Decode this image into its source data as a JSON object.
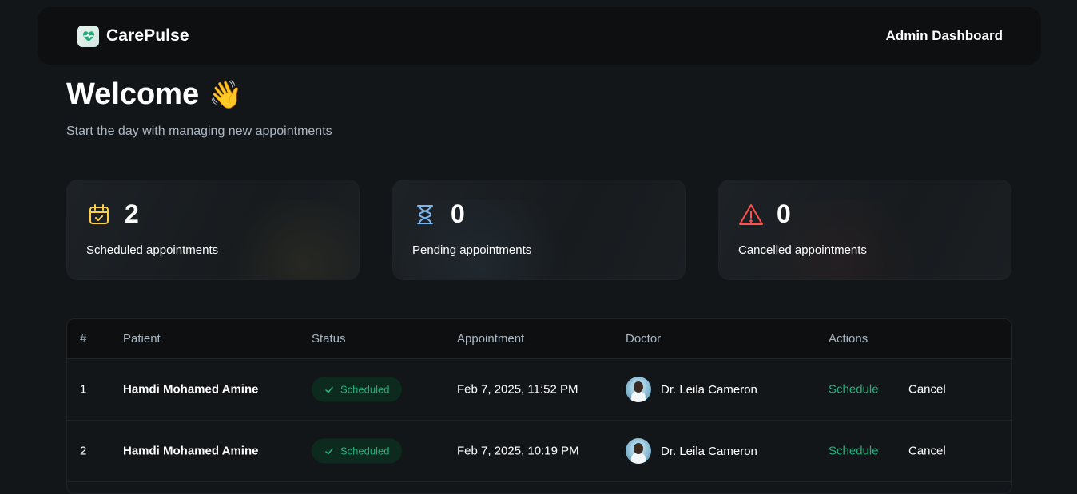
{
  "header": {
    "logo_text": "CarePulse",
    "admin_title": "Admin Dashboard"
  },
  "welcome": {
    "title": "Welcome",
    "emoji": "👋",
    "subtitle": "Start the day with managing new appointments"
  },
  "stats": {
    "scheduled": {
      "count": "2",
      "label": "Scheduled appointments",
      "icon": "calendar-check-icon",
      "color": "#ffd147"
    },
    "pending": {
      "count": "0",
      "label": "Pending appointments",
      "icon": "hourglass-icon",
      "color": "#79b5ec"
    },
    "cancelled": {
      "count": "0",
      "label": "Cancelled appointments",
      "icon": "warning-icon",
      "color": "#ff4f4e"
    }
  },
  "table": {
    "headers": [
      "#",
      "Patient",
      "Status",
      "Appointment",
      "Doctor",
      "Actions"
    ],
    "rows": [
      {
        "num": "1",
        "patient": "Hamdi Mohamed Amine",
        "status": "Scheduled",
        "appointment": "Feb 7, 2025, 11:52 PM",
        "doctor": "Dr. Leila Cameron",
        "action_schedule": "Schedule",
        "action_cancel": "Cancel"
      },
      {
        "num": "2",
        "patient": "Hamdi Mohamed Amine",
        "status": "Scheduled",
        "appointment": "Feb 7, 2025, 10:19 PM",
        "doctor": "Dr. Leila Cameron",
        "action_schedule": "Schedule",
        "action_cancel": "Cancel"
      }
    ]
  },
  "colors": {
    "background": "#131619",
    "accent_green": "#24ae7c",
    "text_muted": "#abb8c4"
  }
}
